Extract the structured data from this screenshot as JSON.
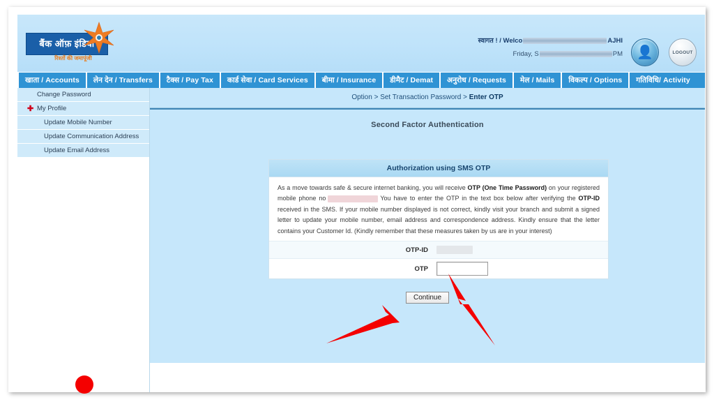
{
  "header": {
    "logo": {
      "bank_name_hindi": "बैंक ऑफ़ इंडिया",
      "tagline_hindi": "रिश्तों की जमापूंजी",
      "star_icon": "star-icon"
    },
    "welcome_prefix": "स्वागत ! / Welco",
    "welcome_suffix": "AJHI",
    "date_prefix": "Friday, S",
    "date_suffix": "PM",
    "user_button_icon": "user-icon",
    "logout_button_label": "LOGOUT"
  },
  "nav": {
    "items": [
      {
        "label": "खाता / Accounts",
        "name": "nav-accounts"
      },
      {
        "label": "लेन देन / Transfers",
        "name": "nav-transfers"
      },
      {
        "label": "टैक्स / Pay Tax",
        "name": "nav-pay-tax"
      },
      {
        "label": "कार्ड सेवा / Card Services",
        "name": "nav-card-services"
      },
      {
        "label": "बीमा / Insurance",
        "name": "nav-insurance"
      },
      {
        "label": "डीमैट / Demat",
        "name": "nav-demat"
      },
      {
        "label": "अनुरोध / Requests",
        "name": "nav-requests"
      },
      {
        "label": "मेल / Mails",
        "name": "nav-mails"
      },
      {
        "label": "विकल्प / Options",
        "name": "nav-options"
      },
      {
        "label": "गतिविधि/ Activity",
        "name": "nav-activity"
      }
    ]
  },
  "sidebar": {
    "items": [
      {
        "label": "Change Password",
        "level": 1,
        "plus": false
      },
      {
        "label": "My Profile",
        "level": 1,
        "plus": true
      },
      {
        "label": "Update Mobile Number",
        "level": 2,
        "plus": false
      },
      {
        "label": "Update Communication Address",
        "level": 2,
        "plus": false
      },
      {
        "label": "Update Email Address",
        "level": 2,
        "plus": false
      }
    ]
  },
  "content": {
    "breadcrumb": {
      "part1": "Option > Set Transaction Password > ",
      "current": "Enter OTP"
    },
    "page_title": "Second Factor Authentication",
    "card": {
      "heading": "Authorization using SMS OTP",
      "body_part1": "As a move towards safe & secure internet banking, you will receive ",
      "body_bold1": "OTP (One Time Password)",
      "body_part2": " on your registered mobile phone no",
      "body_part3": "You have to enter the OTP in the text box below after verifying the ",
      "body_bold2": "OTP-ID",
      "body_part4": " received in the SMS. If your mobile number displayed is not correct, kindly visit your branch and submit a signed letter to update your mobile number, email address and correspondence address. Kindly ensure that the letter contains your Customer Id. (Kindly remember that these measures taken by us are in your interest)",
      "otpid_label": "OTP-ID",
      "otpid_value": "",
      "otp_label": "OTP",
      "otp_value": "",
      "otp_placeholder": ""
    },
    "continue_label": "Continue"
  },
  "annotations": {
    "arrow_to_otp": "arrow-pointing-to-otp-input",
    "arrow_to_continue": "arrow-pointing-to-continue-button",
    "red_dot": "red-dot-marker"
  },
  "colors": {
    "nav_blue": "#2f93d4",
    "content_blue": "#c6e7fb",
    "header_blue": "#c8e7fa",
    "sidebar_item": "#cfeafa",
    "arrow_red": "#f40000",
    "accent_orange": "#e87d1e"
  }
}
